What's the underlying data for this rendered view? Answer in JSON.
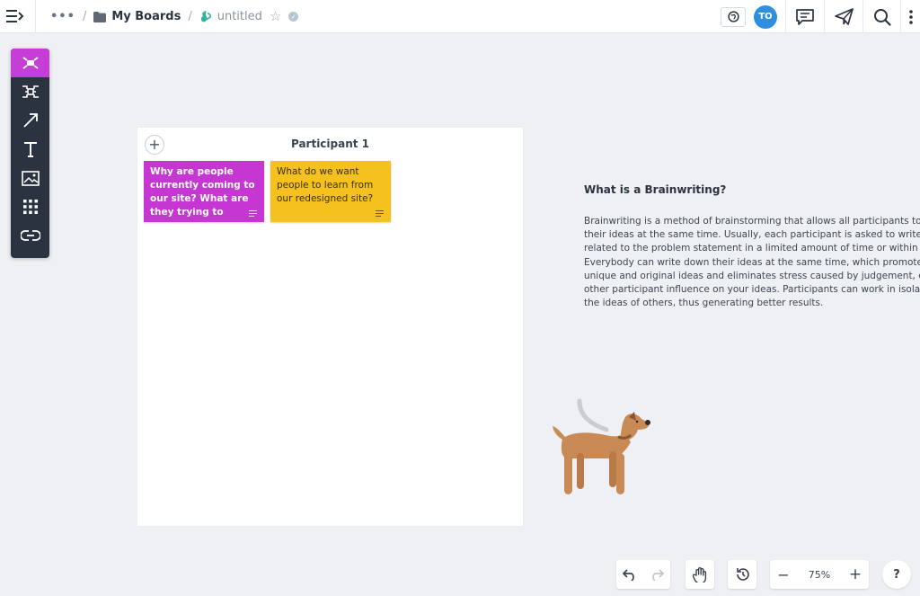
{
  "breadcrumb": {
    "more": "•••",
    "separator": "/",
    "board_folder": "My Boards",
    "board_name": "untitled"
  },
  "user": {
    "initials": "TO"
  },
  "icons": {
    "menu": "menu-collapse-icon",
    "folder": "folder-icon",
    "board": "board-leaf-icon",
    "star": "star-icon",
    "verified": "verified-icon",
    "globe": "globe-icon",
    "comments": "comment-icon",
    "share": "paper-plane-icon",
    "search": "search-icon",
    "more": "vertical-dots-icon"
  },
  "toolbar": {
    "tools": [
      "templates",
      "mind-map",
      "arrow",
      "text",
      "image",
      "grid",
      "link"
    ]
  },
  "frame": {
    "add": "+",
    "title": "Participant 1",
    "stickies": [
      {
        "text": "Why are people currently coming to our site? What are they trying to accomp...",
        "color": "#c536d2"
      },
      {
        "text": "What do we want people to learn from our redesigned site?",
        "color": "#f5c11e"
      }
    ]
  },
  "info": {
    "title": "What is a Brainwriting?",
    "lines": [
      "Brainwriting is a method of brainstorming that allows all participants to contr",
      "their ideas at the same time. Usually, each participant is asked to write down",
      "related to the problem statement in a limited amount of time or within a limite",
      "Everybody can write down their ideas at the same time, which promotes prod",
      "unique and original ideas and eliminates stress caused by judgement, clash o",
      "other participant influence on your ideas. Participants can work in isolation w",
      "the ideas of others, thus generating better results."
    ]
  },
  "bottom": {
    "zoom": "75%",
    "zoom_out": "−",
    "zoom_in": "+",
    "help": "?"
  },
  "colors": {
    "accent_purple": "#c536d2",
    "sticky_yellow": "#f5c11e",
    "toolbar_dark": "#2b3340",
    "avatar_blue": "#2f8ee0"
  }
}
